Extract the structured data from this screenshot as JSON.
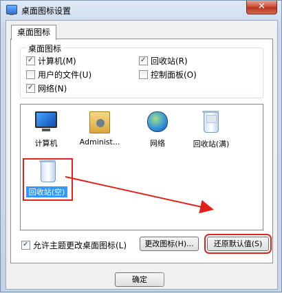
{
  "window": {
    "title": "桌面图标设置",
    "close_label": "✕"
  },
  "tab": {
    "label": "桌面图标"
  },
  "group": {
    "label": "桌面图标",
    "checkboxes": [
      {
        "label": "计算机(M)",
        "checked": true
      },
      {
        "label": "回收站(R)",
        "checked": true
      },
      {
        "label": "用户的文件(U)",
        "checked": false
      },
      {
        "label": "控制面板(O)",
        "checked": false
      },
      {
        "label": "网络(N)",
        "checked": true
      }
    ]
  },
  "icons": [
    {
      "label": "计算机",
      "icon": "computer-icon"
    },
    {
      "label": "Administ...",
      "icon": "user-folder-icon"
    },
    {
      "label": "网络",
      "icon": "network-icon"
    },
    {
      "label": "回收站(满)",
      "icon": "recycle-bin-full-icon"
    },
    {
      "label": "回收站(空)",
      "icon": "recycle-bin-empty-icon"
    }
  ],
  "buttons": {
    "change_icon": "更改图标(H)...",
    "restore_default": "还原默认值(S)",
    "ok": "确定"
  },
  "allow_theme": {
    "label": "允许主题更改桌面图标(L)",
    "checked": true
  },
  "colors": {
    "annotation_red": "#e0211a",
    "selection_blue": "#3399ff"
  }
}
